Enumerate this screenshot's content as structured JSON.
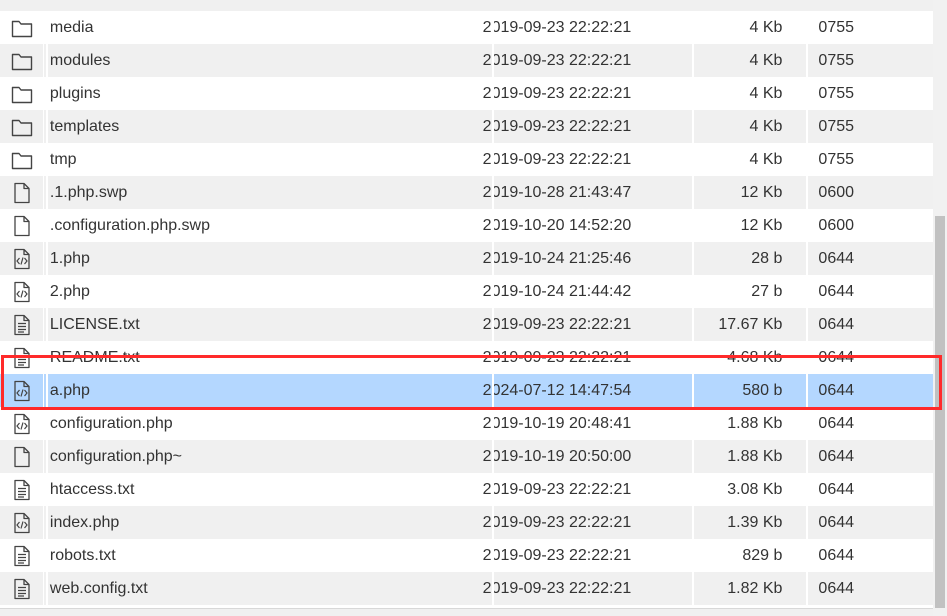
{
  "files": [
    {
      "icon": "folder-icon",
      "name": "media",
      "date": "2019-09-23 22:22:21",
      "size": "4 Kb",
      "perm": "0755"
    },
    {
      "icon": "folder-icon",
      "name": "modules",
      "date": "2019-09-23 22:22:21",
      "size": "4 Kb",
      "perm": "0755"
    },
    {
      "icon": "folder-icon",
      "name": "plugins",
      "date": "2019-09-23 22:22:21",
      "size": "4 Kb",
      "perm": "0755"
    },
    {
      "icon": "folder-icon",
      "name": "templates",
      "date": "2019-09-23 22:22:21",
      "size": "4 Kb",
      "perm": "0755"
    },
    {
      "icon": "folder-icon",
      "name": "tmp",
      "date": "2019-09-23 22:22:21",
      "size": "4 Kb",
      "perm": "0755"
    },
    {
      "icon": "file-icon",
      "name": ".1.php.swp",
      "date": "2019-10-28 21:43:47",
      "size": "12 Kb",
      "perm": "0600"
    },
    {
      "icon": "file-icon",
      "name": ".configuration.php.swp",
      "date": "2019-10-20 14:52:20",
      "size": "12 Kb",
      "perm": "0600"
    },
    {
      "icon": "code-file-icon",
      "name": "1.php",
      "date": "2019-10-24 21:25:46",
      "size": "28 b",
      "perm": "0644"
    },
    {
      "icon": "code-file-icon",
      "name": "2.php",
      "date": "2019-10-24 21:44:42",
      "size": "27 b",
      "perm": "0644"
    },
    {
      "icon": "text-file-icon",
      "name": "LICENSE.txt",
      "date": "2019-09-23 22:22:21",
      "size": "17.67 Kb",
      "perm": "0644"
    },
    {
      "icon": "text-file-icon",
      "name": "README.txt",
      "date": "2019-09-23 22:22:21",
      "size": "4.68 Kb",
      "perm": "0644"
    },
    {
      "icon": "code-file-icon",
      "name": "a.php",
      "date": "2024-07-12 14:47:54",
      "size": "580 b",
      "perm": "0644",
      "selected": true
    },
    {
      "icon": "code-file-icon",
      "name": "configuration.php",
      "date": "2019-10-19 20:48:41",
      "size": "1.88 Kb",
      "perm": "0644"
    },
    {
      "icon": "file-icon",
      "name": "configuration.php~",
      "date": "2019-10-19 20:50:00",
      "size": "1.88 Kb",
      "perm": "0644"
    },
    {
      "icon": "text-file-icon",
      "name": "htaccess.txt",
      "date": "2019-09-23 22:22:21",
      "size": "3.08 Kb",
      "perm": "0644"
    },
    {
      "icon": "code-file-icon",
      "name": "index.php",
      "date": "2019-09-23 22:22:21",
      "size": "1.39 Kb",
      "perm": "0644"
    },
    {
      "icon": "text-file-icon",
      "name": "robots.txt",
      "date": "2019-09-23 22:22:21",
      "size": "829 b",
      "perm": "0644"
    },
    {
      "icon": "text-file-icon",
      "name": "web.config.txt",
      "date": "2019-09-23 22:22:21",
      "size": "1.82 Kb",
      "perm": "0644"
    }
  ],
  "colors": {
    "row_even": "#f0f0f0",
    "row_selected": "#b4d7ff",
    "highlight_border": "#ff2a2a",
    "icon_stroke": "#444444"
  }
}
